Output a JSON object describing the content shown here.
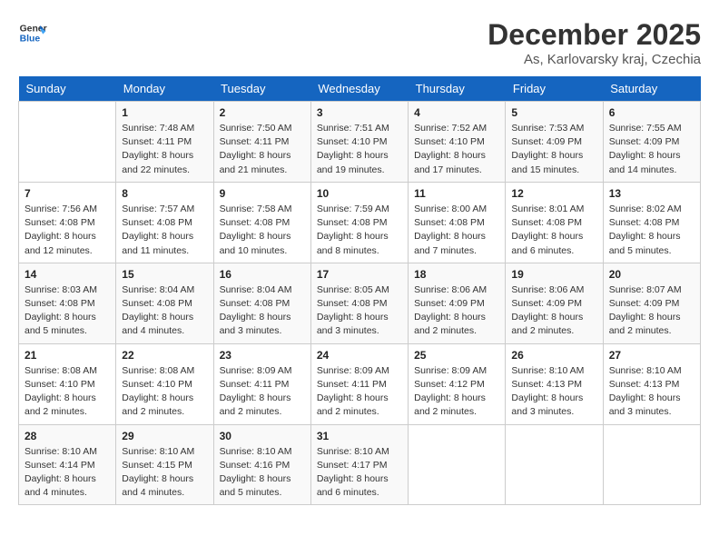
{
  "header": {
    "logo_line1": "General",
    "logo_line2": "Blue",
    "month": "December 2025",
    "location": "As, Karlovarsky kraj, Czechia"
  },
  "days_of_week": [
    "Sunday",
    "Monday",
    "Tuesday",
    "Wednesday",
    "Thursday",
    "Friday",
    "Saturday"
  ],
  "weeks": [
    [
      {
        "day": "",
        "sunrise": "",
        "sunset": "",
        "daylight": ""
      },
      {
        "day": "1",
        "sunrise": "Sunrise: 7:48 AM",
        "sunset": "Sunset: 4:11 PM",
        "daylight": "Daylight: 8 hours and 22 minutes."
      },
      {
        "day": "2",
        "sunrise": "Sunrise: 7:50 AM",
        "sunset": "Sunset: 4:11 PM",
        "daylight": "Daylight: 8 hours and 21 minutes."
      },
      {
        "day": "3",
        "sunrise": "Sunrise: 7:51 AM",
        "sunset": "Sunset: 4:10 PM",
        "daylight": "Daylight: 8 hours and 19 minutes."
      },
      {
        "day": "4",
        "sunrise": "Sunrise: 7:52 AM",
        "sunset": "Sunset: 4:10 PM",
        "daylight": "Daylight: 8 hours and 17 minutes."
      },
      {
        "day": "5",
        "sunrise": "Sunrise: 7:53 AM",
        "sunset": "Sunset: 4:09 PM",
        "daylight": "Daylight: 8 hours and 15 minutes."
      },
      {
        "day": "6",
        "sunrise": "Sunrise: 7:55 AM",
        "sunset": "Sunset: 4:09 PM",
        "daylight": "Daylight: 8 hours and 14 minutes."
      }
    ],
    [
      {
        "day": "7",
        "sunrise": "Sunrise: 7:56 AM",
        "sunset": "Sunset: 4:08 PM",
        "daylight": "Daylight: 8 hours and 12 minutes."
      },
      {
        "day": "8",
        "sunrise": "Sunrise: 7:57 AM",
        "sunset": "Sunset: 4:08 PM",
        "daylight": "Daylight: 8 hours and 11 minutes."
      },
      {
        "day": "9",
        "sunrise": "Sunrise: 7:58 AM",
        "sunset": "Sunset: 4:08 PM",
        "daylight": "Daylight: 8 hours and 10 minutes."
      },
      {
        "day": "10",
        "sunrise": "Sunrise: 7:59 AM",
        "sunset": "Sunset: 4:08 PM",
        "daylight": "Daylight: 8 hours and 8 minutes."
      },
      {
        "day": "11",
        "sunrise": "Sunrise: 8:00 AM",
        "sunset": "Sunset: 4:08 PM",
        "daylight": "Daylight: 8 hours and 7 minutes."
      },
      {
        "day": "12",
        "sunrise": "Sunrise: 8:01 AM",
        "sunset": "Sunset: 4:08 PM",
        "daylight": "Daylight: 8 hours and 6 minutes."
      },
      {
        "day": "13",
        "sunrise": "Sunrise: 8:02 AM",
        "sunset": "Sunset: 4:08 PM",
        "daylight": "Daylight: 8 hours and 5 minutes."
      }
    ],
    [
      {
        "day": "14",
        "sunrise": "Sunrise: 8:03 AM",
        "sunset": "Sunset: 4:08 PM",
        "daylight": "Daylight: 8 hours and 5 minutes."
      },
      {
        "day": "15",
        "sunrise": "Sunrise: 8:04 AM",
        "sunset": "Sunset: 4:08 PM",
        "daylight": "Daylight: 8 hours and 4 minutes."
      },
      {
        "day": "16",
        "sunrise": "Sunrise: 8:04 AM",
        "sunset": "Sunset: 4:08 PM",
        "daylight": "Daylight: 8 hours and 3 minutes."
      },
      {
        "day": "17",
        "sunrise": "Sunrise: 8:05 AM",
        "sunset": "Sunset: 4:08 PM",
        "daylight": "Daylight: 8 hours and 3 minutes."
      },
      {
        "day": "18",
        "sunrise": "Sunrise: 8:06 AM",
        "sunset": "Sunset: 4:09 PM",
        "daylight": "Daylight: 8 hours and 2 minutes."
      },
      {
        "day": "19",
        "sunrise": "Sunrise: 8:06 AM",
        "sunset": "Sunset: 4:09 PM",
        "daylight": "Daylight: 8 hours and 2 minutes."
      },
      {
        "day": "20",
        "sunrise": "Sunrise: 8:07 AM",
        "sunset": "Sunset: 4:09 PM",
        "daylight": "Daylight: 8 hours and 2 minutes."
      }
    ],
    [
      {
        "day": "21",
        "sunrise": "Sunrise: 8:08 AM",
        "sunset": "Sunset: 4:10 PM",
        "daylight": "Daylight: 8 hours and 2 minutes."
      },
      {
        "day": "22",
        "sunrise": "Sunrise: 8:08 AM",
        "sunset": "Sunset: 4:10 PM",
        "daylight": "Daylight: 8 hours and 2 minutes."
      },
      {
        "day": "23",
        "sunrise": "Sunrise: 8:09 AM",
        "sunset": "Sunset: 4:11 PM",
        "daylight": "Daylight: 8 hours and 2 minutes."
      },
      {
        "day": "24",
        "sunrise": "Sunrise: 8:09 AM",
        "sunset": "Sunset: 4:11 PM",
        "daylight": "Daylight: 8 hours and 2 minutes."
      },
      {
        "day": "25",
        "sunrise": "Sunrise: 8:09 AM",
        "sunset": "Sunset: 4:12 PM",
        "daylight": "Daylight: 8 hours and 2 minutes."
      },
      {
        "day": "26",
        "sunrise": "Sunrise: 8:10 AM",
        "sunset": "Sunset: 4:13 PM",
        "daylight": "Daylight: 8 hours and 3 minutes."
      },
      {
        "day": "27",
        "sunrise": "Sunrise: 8:10 AM",
        "sunset": "Sunset: 4:13 PM",
        "daylight": "Daylight: 8 hours and 3 minutes."
      }
    ],
    [
      {
        "day": "28",
        "sunrise": "Sunrise: 8:10 AM",
        "sunset": "Sunset: 4:14 PM",
        "daylight": "Daylight: 8 hours and 4 minutes."
      },
      {
        "day": "29",
        "sunrise": "Sunrise: 8:10 AM",
        "sunset": "Sunset: 4:15 PM",
        "daylight": "Daylight: 8 hours and 4 minutes."
      },
      {
        "day": "30",
        "sunrise": "Sunrise: 8:10 AM",
        "sunset": "Sunset: 4:16 PM",
        "daylight": "Daylight: 8 hours and 5 minutes."
      },
      {
        "day": "31",
        "sunrise": "Sunrise: 8:10 AM",
        "sunset": "Sunset: 4:17 PM",
        "daylight": "Daylight: 8 hours and 6 minutes."
      },
      {
        "day": "",
        "sunrise": "",
        "sunset": "",
        "daylight": ""
      },
      {
        "day": "",
        "sunrise": "",
        "sunset": "",
        "daylight": ""
      },
      {
        "day": "",
        "sunrise": "",
        "sunset": "",
        "daylight": ""
      }
    ]
  ]
}
